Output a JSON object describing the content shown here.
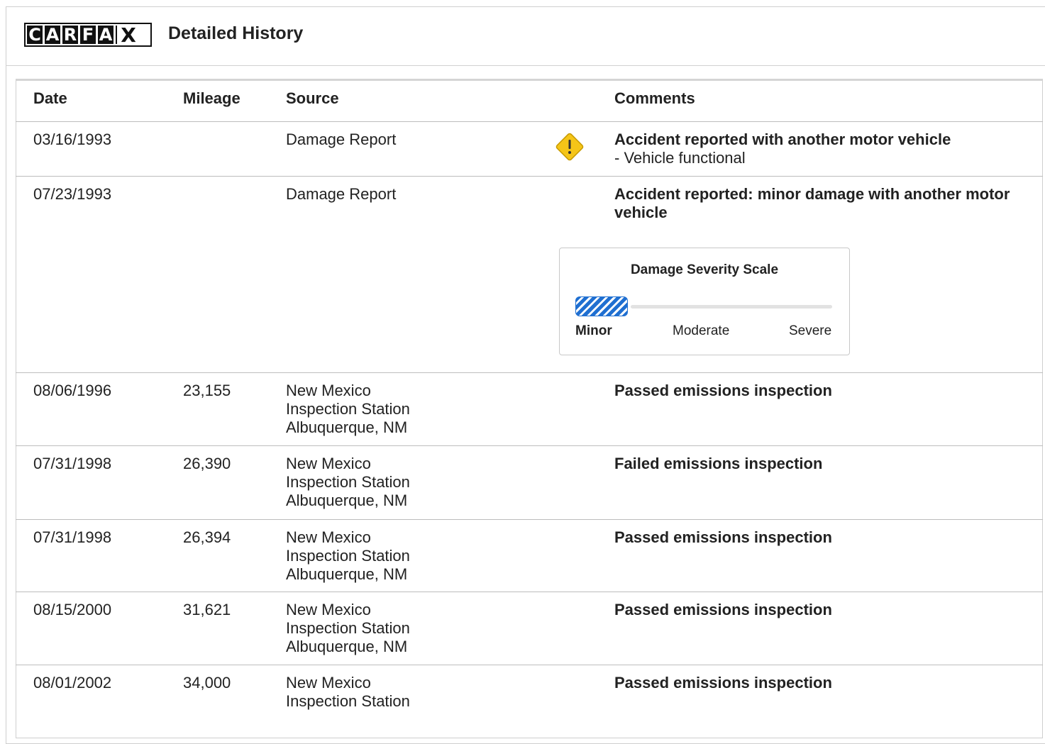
{
  "header": {
    "logo_letters": [
      "C",
      "A",
      "R",
      "F",
      "A",
      "X"
    ],
    "title": "Detailed History"
  },
  "table": {
    "columns": [
      "Date",
      "Mileage",
      "Source",
      "Comments"
    ],
    "rows": [
      {
        "date": "03/16/1993",
        "mileage": "",
        "source": [
          "Damage Report"
        ],
        "icon": "warning-diamond-icon",
        "comment_bold": "Accident reported with another motor vehicle",
        "comment_detail": "- Vehicle functional"
      },
      {
        "date": "07/23/1993",
        "mileage": "",
        "source": [
          "Damage Report"
        ],
        "comment_bold_lines": [
          "Accident reported: minor damage with another motor",
          "vehicle"
        ]
      },
      {
        "date": "08/06/1996",
        "mileage": "23,155",
        "source": [
          "New Mexico",
          "Inspection Station",
          "Albuquerque, NM"
        ],
        "comment_bold": "Passed emissions inspection"
      },
      {
        "date": "07/31/1998",
        "mileage": "26,390",
        "source": [
          "New Mexico",
          "Inspection Station",
          "Albuquerque, NM"
        ],
        "comment_bold": "Failed emissions inspection"
      },
      {
        "date": "07/31/1998",
        "mileage": "26,394",
        "source": [
          "New Mexico",
          "Inspection Station",
          "Albuquerque, NM"
        ],
        "comment_bold": "Passed emissions inspection"
      },
      {
        "date": "08/15/2000",
        "mileage": "31,621",
        "source": [
          "New Mexico",
          "Inspection Station",
          "Albuquerque, NM"
        ],
        "comment_bold": "Passed emissions inspection"
      },
      {
        "date": "08/01/2002",
        "mileage": "34,000",
        "source": [
          "New Mexico",
          "Inspection Station"
        ],
        "comment_bold": "Passed emissions inspection"
      }
    ]
  },
  "damage_scale": {
    "title": "Damage Severity Scale",
    "labels": [
      "Minor",
      "Moderate",
      "Severe"
    ],
    "selected": "Minor",
    "fill_color": "#1f6fd1"
  },
  "colors": {
    "warning": "#f5c518",
    "border": "#bdbdbd"
  }
}
